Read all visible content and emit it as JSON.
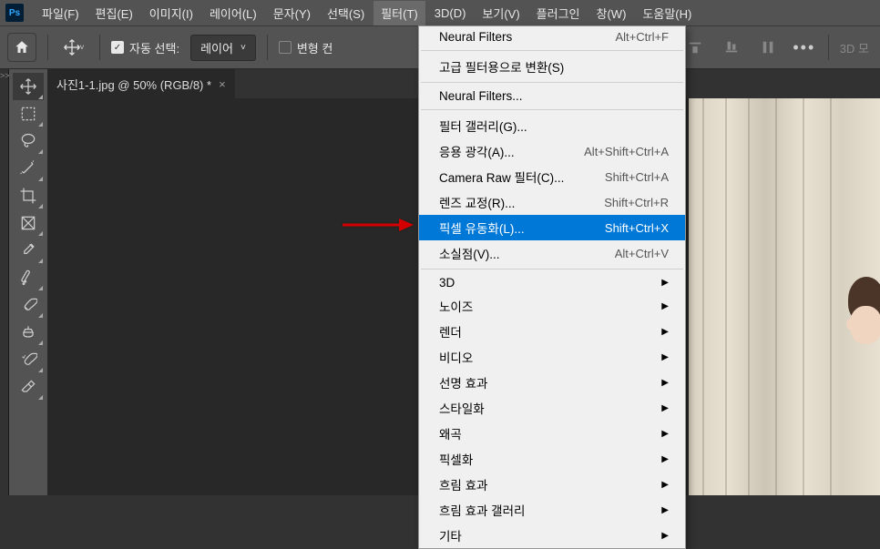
{
  "app": {
    "logo": "Ps"
  },
  "menubar": [
    "파일(F)",
    "편집(E)",
    "이미지(I)",
    "레이어(L)",
    "문자(Y)",
    "선택(S)",
    "필터(T)",
    "3D(D)",
    "보기(V)",
    "플러그인",
    "창(W)",
    "도움말(H)"
  ],
  "menubar_active_index": 6,
  "options": {
    "auto_select_label": "자동 선택:",
    "auto_select_checked": true,
    "layer_dropdown": "레이어",
    "transform_label": "변형 컨",
    "transform_checked": false,
    "three_d": "3D 모"
  },
  "tab": {
    "title": "사진1-1.jpg @ 50% (RGB/8) *",
    "close": "×"
  },
  "gutter": ">>",
  "filter_menu": {
    "rows": [
      {
        "label": "Neural Filters",
        "shortcut": "Alt+Ctrl+F",
        "type": "item"
      },
      {
        "type": "sep"
      },
      {
        "label": "고급 필터용으로 변환(S)",
        "type": "item"
      },
      {
        "type": "sep"
      },
      {
        "label": "Neural Filters...",
        "type": "item"
      },
      {
        "type": "sep"
      },
      {
        "label": "필터 갤러리(G)...",
        "type": "item"
      },
      {
        "label": "응용 광각(A)...",
        "shortcut": "Alt+Shift+Ctrl+A",
        "type": "item"
      },
      {
        "label": "Camera Raw 필터(C)...",
        "shortcut": "Shift+Ctrl+A",
        "type": "item"
      },
      {
        "label": "렌즈 교정(R)...",
        "shortcut": "Shift+Ctrl+R",
        "type": "item"
      },
      {
        "label": "픽셀 유동화(L)...",
        "shortcut": "Shift+Ctrl+X",
        "type": "item",
        "highlighted": true
      },
      {
        "label": "소실점(V)...",
        "shortcut": "Alt+Ctrl+V",
        "type": "item"
      },
      {
        "type": "sep"
      },
      {
        "label": "3D",
        "type": "submenu"
      },
      {
        "label": "노이즈",
        "type": "submenu"
      },
      {
        "label": "렌더",
        "type": "submenu"
      },
      {
        "label": "비디오",
        "type": "submenu"
      },
      {
        "label": "선명 효과",
        "type": "submenu"
      },
      {
        "label": "스타일화",
        "type": "submenu"
      },
      {
        "label": "왜곡",
        "type": "submenu"
      },
      {
        "label": "픽셀화",
        "type": "submenu"
      },
      {
        "label": "흐림 효과",
        "type": "submenu"
      },
      {
        "label": "흐림 효과 갤러리",
        "type": "submenu"
      },
      {
        "label": "기타",
        "type": "submenu"
      }
    ]
  }
}
